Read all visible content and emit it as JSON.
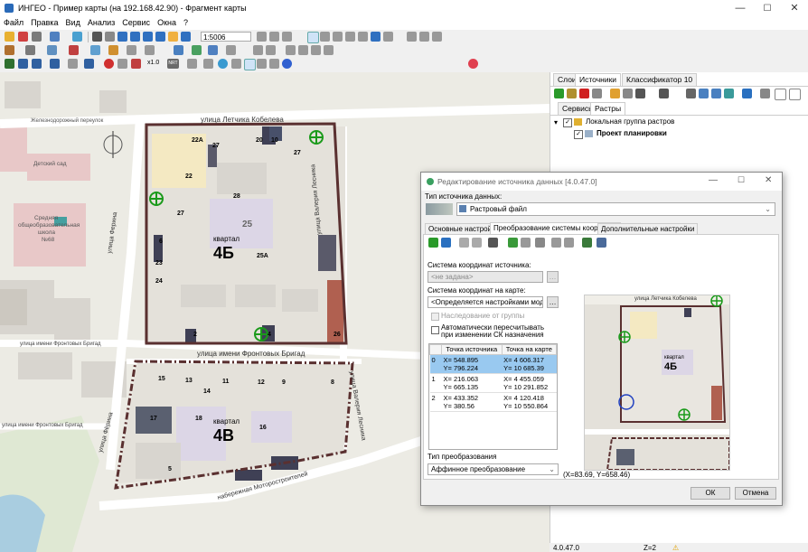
{
  "window": {
    "title": "ИНГЕО - Пример карты (на 192.168.42.90) - Фрагмент карты",
    "minimize": "—",
    "maximize": "☐",
    "close": "✕"
  },
  "menu": [
    "Файл",
    "Правка",
    "Вид",
    "Анализ",
    "Сервис",
    "Окна",
    "?"
  ],
  "toolbar": {
    "scale": "1:5006",
    "zoom_label": "x1.0",
    "nrt_label": "NRT"
  },
  "map": {
    "streets": {
      "letchika_kobeleva": "улица Летчика Кобелева",
      "frontovyh_brigad_1": "улица имени Фронтовых Бригад",
      "frontovyh_brigad_2": "улица имени Фронтовых Бригад",
      "frontovyh_brigad_3": "улица имени Фронтовых Бригад",
      "ferina": "улица Ферина",
      "ferina_2": "улица Фёрина",
      "valeriya_lesnika": "улица Валерия Лесника",
      "valeriya_lesnika_2": "улица Валерия Лесника",
      "motorostroiteley": "набережная Моторостроителей",
      "zheleznodorozhny": "Железнодорожный переулок"
    },
    "pois": {
      "kindergarten": "Детский сад",
      "school_1": "Средняя",
      "school_2": "общеобразовательная",
      "school_3": "школа",
      "school_4": "№68"
    },
    "blocks": {
      "b4b_word": "квартал",
      "b4b_num": "4Б",
      "b4v_word": "квартал",
      "b4v_num": "4В"
    },
    "house_numbers": [
      "22А",
      "20",
      "10",
      "27",
      "22",
      "27",
      "28",
      "23",
      "24",
      "25",
      "25А",
      "26",
      "2",
      "4",
      "6",
      "17",
      "18",
      "16",
      "15",
      "13",
      "14",
      "11",
      "12",
      "9",
      "8",
      "27",
      "5"
    ]
  },
  "right_panel": {
    "tabs": [
      "Слои",
      "Источники",
      "Классификатор 10"
    ],
    "active_tab": "Источники",
    "subtabs": [
      "Сервисы",
      "Растры"
    ],
    "active_subtab": "Растры",
    "tree": {
      "group_label": "Локальная группа растров",
      "item_label": "Проект планировки"
    }
  },
  "statusbar": {
    "version": "4.0.47.0",
    "z": "Z=2"
  },
  "dialog": {
    "title": "Редактирование источника данных [4.0.47.0]",
    "source_type_label": "Тип источника данных:",
    "source_type_value": "Растровый файл",
    "tabs": [
      "Основные настройки",
      "Преобразование системы координат",
      "Дополнительные настройки"
    ],
    "active_tab": "Преобразование системы координат",
    "source_cs_label": "Система координат источника:",
    "source_cs_value": "<не задана>",
    "map_cs_label": "Система координат на карте:",
    "map_cs_value": "<Определяется настройками модуля",
    "inherit_label": "Наследование от группы",
    "auto_recalc_label": "Автоматически пересчитывать при изменении СК назначения",
    "table_headers": [
      "Точка источника",
      "Точка на карте"
    ],
    "points": [
      {
        "n": "0",
        "src_x": "X= 548.895",
        "src_y": "Y= 796.224",
        "map_x": "X= 4 606.317",
        "map_y": "Y= 10 685.39"
      },
      {
        "n": "1",
        "src_x": "X= 216.063",
        "src_y": "Y= 665.135",
        "map_x": "X= 4 455.059",
        "map_y": "Y= 10 291.852"
      },
      {
        "n": "2",
        "src_x": "X= 433.352",
        "src_y": "Y= 380.56",
        "map_x": "X= 4 120.418",
        "map_y": "Y= 10 550.864"
      }
    ],
    "transform_label": "Тип преобразования",
    "transform_value": "Аффинное преобразование",
    "preview": {
      "street": "улица Летчика Кобелева",
      "block_word": "квартал",
      "block_num": "4Б",
      "coords": "(X=83.69, Y=658.46)"
    },
    "ok": "ОК",
    "cancel": "Отмена"
  },
  "colors": {
    "map_bg": "#ecebe4",
    "road": "#ffffff",
    "building_gray": "#d8d5cf",
    "boundary": "#5a3030",
    "dialog_selection": "#99c9f0",
    "gcp_marker": "#1a9a1a"
  }
}
